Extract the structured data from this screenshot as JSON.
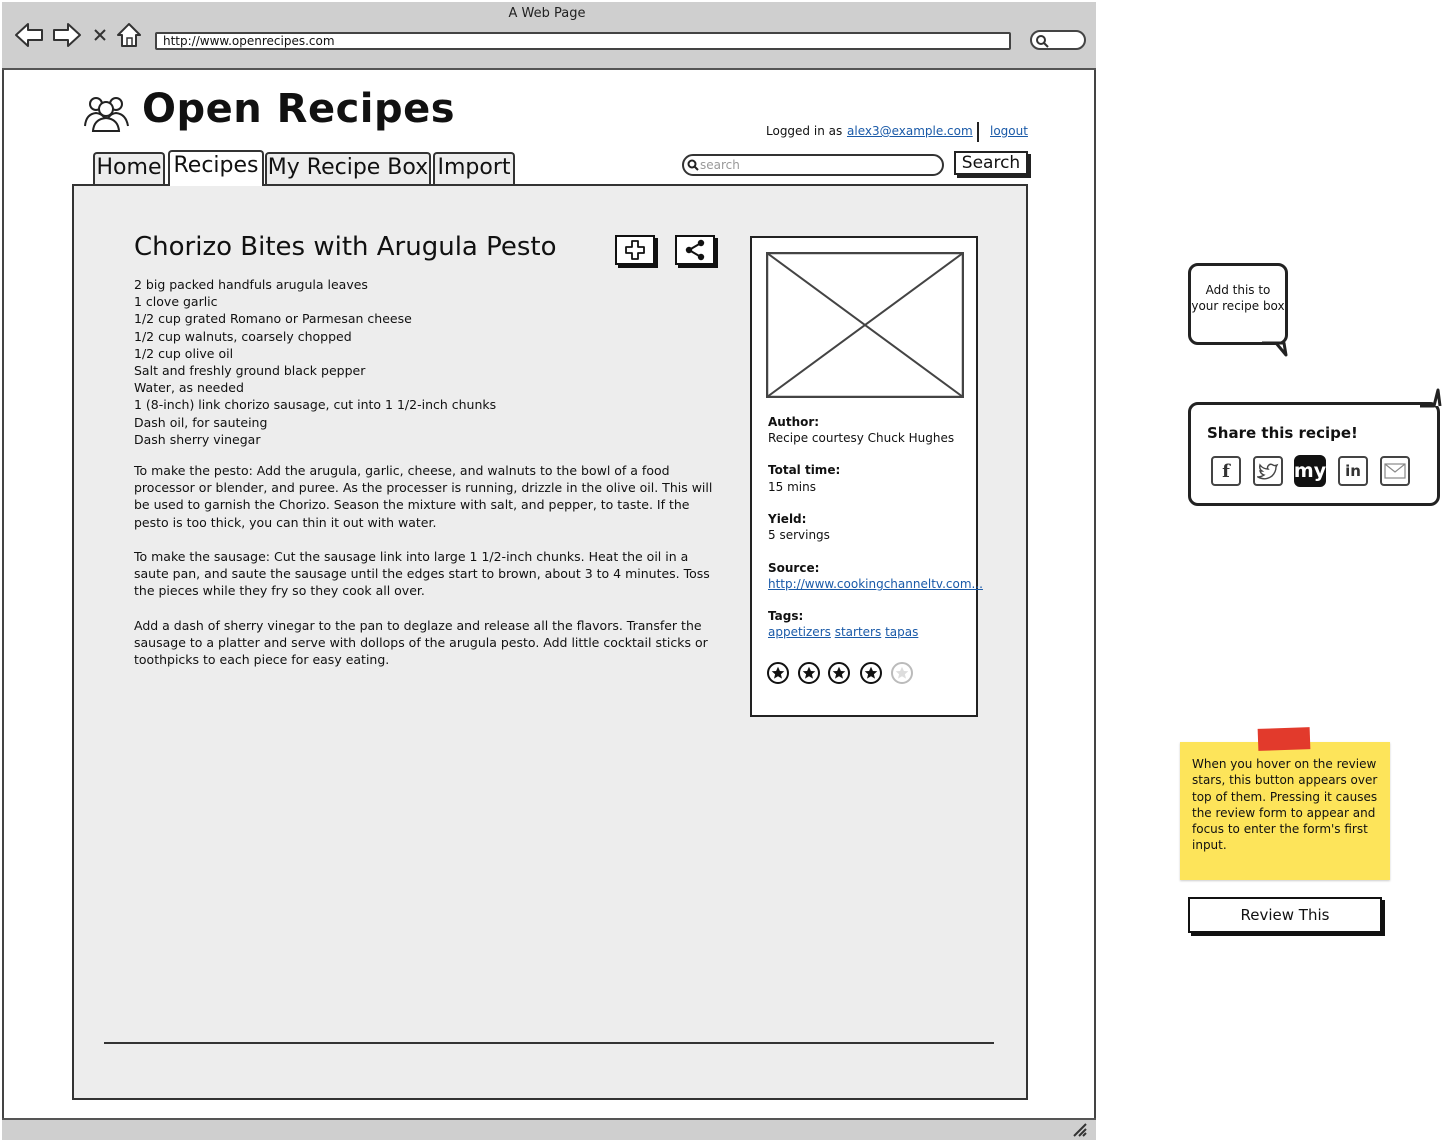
{
  "browser": {
    "window_title": "A Web Page",
    "url": "http://www.openrecipes.com"
  },
  "header": {
    "site_title": "Open Recipes",
    "logged_in_label": "Logged in as",
    "user_email": "alex3@example.com",
    "logout_label": "logout"
  },
  "tabs": [
    {
      "label": "Home"
    },
    {
      "label": "Recipes"
    },
    {
      "label": "My Recipe Box"
    },
    {
      "label": "Import"
    }
  ],
  "search": {
    "placeholder": "search",
    "button_label": "Search"
  },
  "recipe": {
    "title": "Chorizo Bites with Arugula Pesto",
    "ingredients": [
      "2 big packed handfuls arugula leaves",
      "1 clove garlic",
      "1/2 cup grated Romano or Parmesan cheese",
      "1/2 cup walnuts, coarsely chopped",
      "1/2 cup olive oil",
      "Salt and freshly ground black pepper",
      "Water, as needed",
      "1 (8-inch) link chorizo sausage, cut into 1 1/2-inch chunks",
      "Dash oil, for sauteing",
      "Dash sherry vinegar"
    ],
    "steps": [
      "To make the pesto: Add the arugula, garlic, cheese, and walnuts to the bowl of a food processor or blender, and puree. As the processer is running, drizzle in the olive oil. This will be used to garnish the Chorizo. Season the mixture with salt, and pepper, to taste. If the pesto is too thick, you can thin it out with water.",
      "To make the sausage: Cut the sausage link into large 1 1/2-inch chunks. Heat the oil in a saute pan, and saute the sausage until the edges start to brown, about 3 to 4 minutes. Toss the pieces while they fry so they cook all over.",
      "Add a dash of sherry vinegar to the pan to deglaze and release all the flavors. Transfer the sausage to a platter and serve with dollops of the arugula pesto. Add little cocktail sticks or toothpicks to each piece for easy eating."
    ]
  },
  "card": {
    "author_label": "Author:",
    "author_value": "Recipe courtesy Chuck Hughes",
    "time_label": "Total time:",
    "time_value": "15 mins",
    "yield_label": "Yield:",
    "yield_value": "5 servings",
    "source_label": "Source:",
    "source_value": "http://www.cookingchanneltv.com...",
    "tags_label": "Tags:",
    "tags": [
      "appetizers",
      "starters",
      "tapas"
    ],
    "rating": 4,
    "rating_max": 5
  },
  "annotations": {
    "add_bubble": "Add this to your recipe box",
    "share_title": "Share this recipe!",
    "share_icons": [
      "facebook-icon",
      "twitter-icon",
      "myspace-icon",
      "linkedin-icon",
      "email-icon"
    ],
    "myspace_text": "my",
    "linkedin_text": "in",
    "facebook_text": "f",
    "sticky_note": "When you hover on the review stars, this button appears over top of them. Pressing it causes the review form to appear and focus to enter the form's first input.",
    "review_button": "Review This"
  },
  "colors": {
    "panel": "#ededed",
    "link": "#1a5aa8",
    "sticky": "#fde45a",
    "tape": "#e23a2c"
  }
}
